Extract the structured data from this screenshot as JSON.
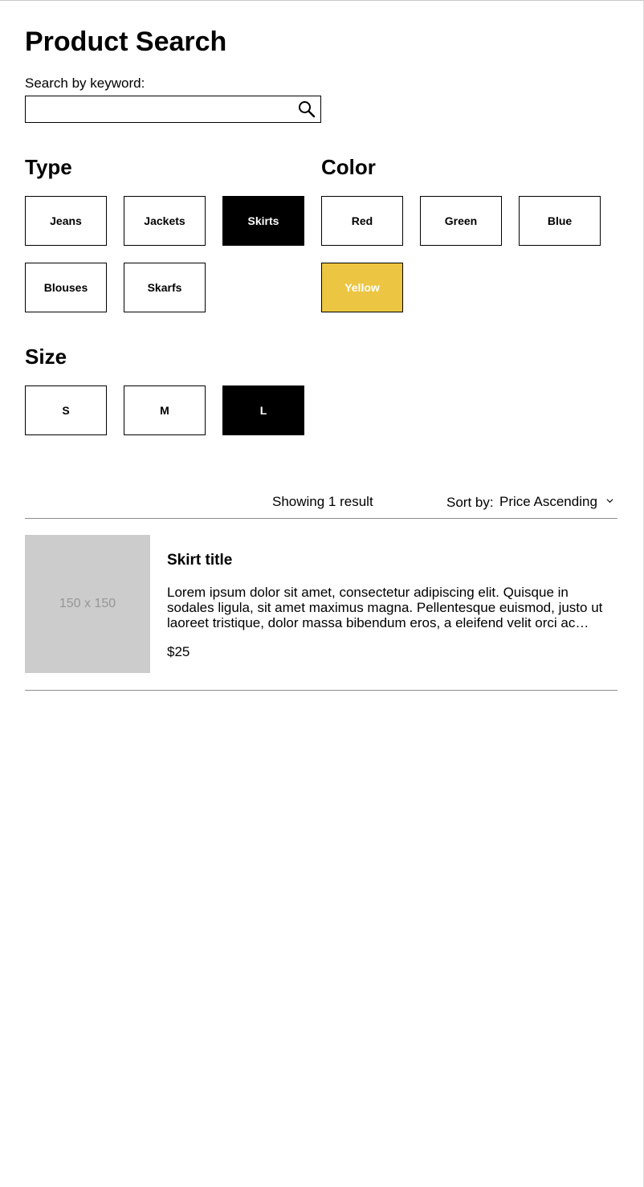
{
  "page": {
    "title": "Product Search"
  },
  "search": {
    "label": "Search by keyword:",
    "value": "",
    "placeholder": ""
  },
  "filters": {
    "type": {
      "title": "Type",
      "options": [
        {
          "label": "Jeans",
          "selected": false
        },
        {
          "label": "Jackets",
          "selected": false
        },
        {
          "label": "Skirts",
          "selected": true
        },
        {
          "label": "Blouses",
          "selected": false
        },
        {
          "label": "Skarfs",
          "selected": false
        }
      ]
    },
    "color": {
      "title": "Color",
      "options": [
        {
          "label": "Red",
          "selected": false
        },
        {
          "label": "Green",
          "selected": false
        },
        {
          "label": "Blue",
          "selected": false
        },
        {
          "label": "Yellow",
          "selected": true,
          "fill": "#ecc642"
        }
      ]
    },
    "size": {
      "title": "Size",
      "options": [
        {
          "label": "S",
          "selected": false
        },
        {
          "label": "M",
          "selected": false
        },
        {
          "label": "L",
          "selected": true
        }
      ]
    }
  },
  "results": {
    "count_text": "Showing 1 result",
    "sort_label": "Sort by:",
    "sort_value": "Price Ascending",
    "items": [
      {
        "image_placeholder": "150 x 150",
        "title": "Skirt title",
        "description": "Lorem ipsum dolor sit amet, consectetur adipiscing elit. Quisque in sodales ligula, sit amet maximus magna. Pellentesque euismod, justo ut laoreet tristique, dolor massa bibendum eros, a eleifend velit orci ac sapien. Class aptent taciti sociosqu ad litora torquent per conubia nostra.",
        "price": "$25"
      }
    ]
  },
  "colors": {
    "selected_bg": "#000000",
    "yellow": "#ecc642",
    "image_placeholder_bg": "#cccccc",
    "divider": "#8c8c8c"
  },
  "icons": {
    "search": "search-icon",
    "sort": "chevron-down-icon"
  }
}
